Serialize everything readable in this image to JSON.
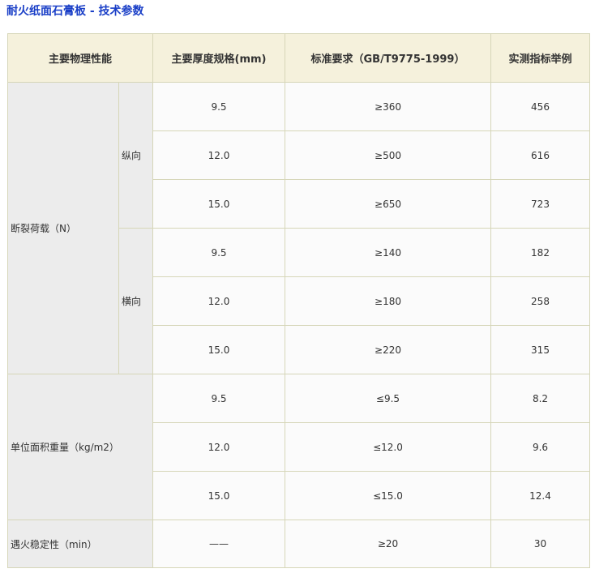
{
  "title": "耐火纸面石膏板 - 技术参数",
  "table": {
    "headers": [
      "主要物理性能",
      "主要厚度规格(mm)",
      "标准要求（GB/T9775-1999）",
      "实测指标举例"
    ],
    "properties": {
      "breaking_load": "断裂荷载（N）",
      "unit_weight": "单位面积重量（kg/m2）",
      "fire_stability": "遇火稳定性（min）"
    },
    "directions": {
      "longitudinal": "纵向",
      "transverse": "横向"
    },
    "rows": [
      {
        "thickness": "9.5",
        "standard": "≥360",
        "measured": "456"
      },
      {
        "thickness": "12.0",
        "standard": "≥500",
        "measured": "616"
      },
      {
        "thickness": "15.0",
        "standard": "≥650",
        "measured": "723"
      },
      {
        "thickness": "9.5",
        "standard": "≥140",
        "measured": "182"
      },
      {
        "thickness": "12.0",
        "standard": "≥180",
        "measured": "258"
      },
      {
        "thickness": "15.0",
        "standard": "≥220",
        "measured": "315"
      },
      {
        "thickness": "9.5",
        "standard": "≤9.5",
        "measured": "8.2"
      },
      {
        "thickness": "12.0",
        "standard": "≤12.0",
        "measured": "9.6"
      },
      {
        "thickness": "15.0",
        "standard": "≤15.0",
        "measured": "12.4"
      },
      {
        "thickness": "——",
        "standard": "≥20",
        "measured": "30"
      }
    ]
  }
}
